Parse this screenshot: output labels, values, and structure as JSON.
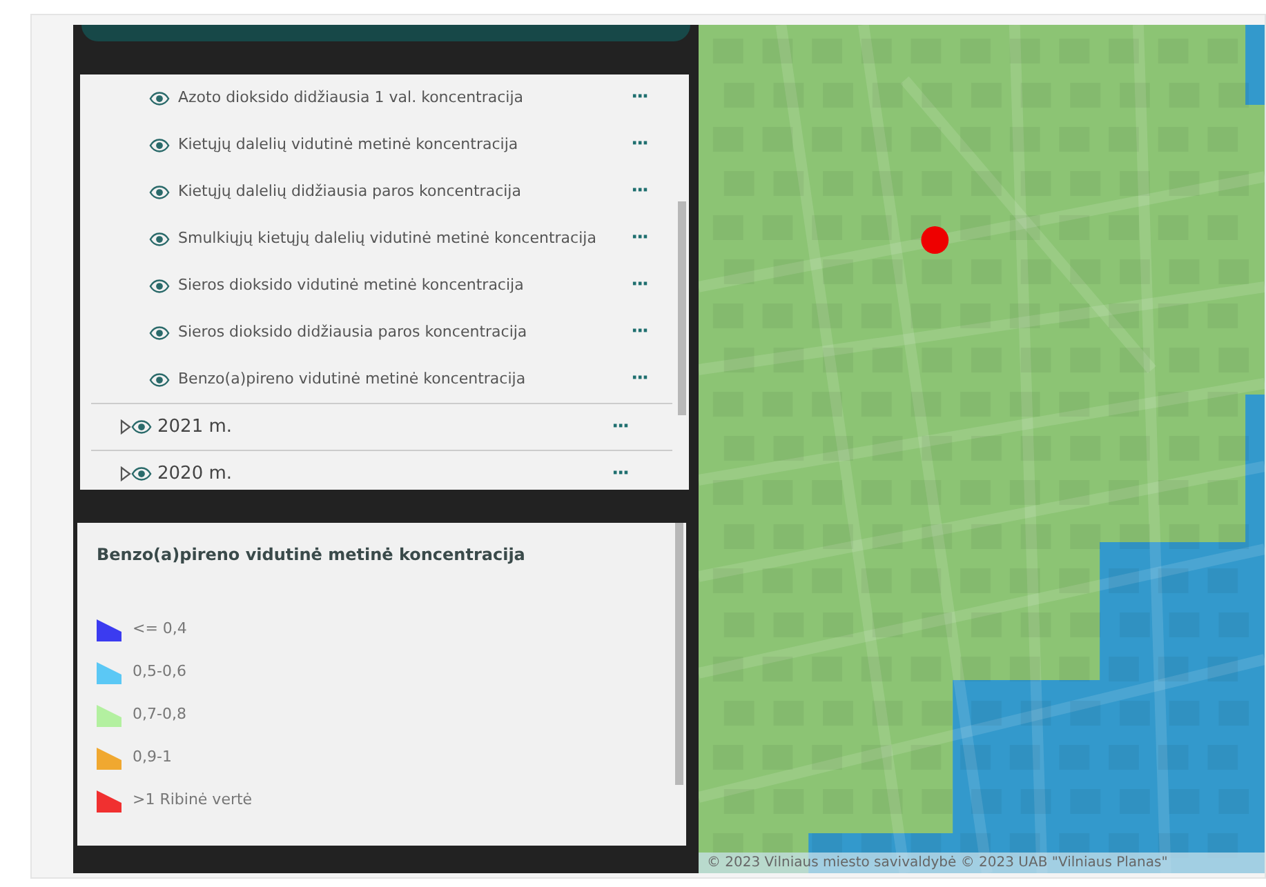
{
  "layers": {
    "items": [
      {
        "kind": "layer",
        "label": "Azoto dioksido didžiausia 1 val. koncentracija",
        "menu": "···"
      },
      {
        "kind": "layer",
        "label": "Kietųjų dalelių vidutinė metinė koncentracija",
        "menu": "···"
      },
      {
        "kind": "layer",
        "label": "Kietųjų dalelių didžiausia paros koncentracija",
        "menu": "···"
      },
      {
        "kind": "layer",
        "label": "Smulkiųjų kietųjų dalelių vidutinė metinė koncentracija",
        "menu": "···"
      },
      {
        "kind": "layer",
        "label": "Sieros dioksido vidutinė metinė koncentracija",
        "menu": "···"
      },
      {
        "kind": "layer",
        "label": "Sieros dioksido didžiausia paros koncentracija",
        "menu": "···"
      },
      {
        "kind": "layer",
        "label": "Benzo(a)pireno vidutinė metinė koncentracija",
        "menu": "···"
      },
      {
        "kind": "group",
        "label": "2021 m.",
        "expanded": false,
        "menu": "···"
      },
      {
        "kind": "group",
        "label": "2020 m.",
        "expanded": false,
        "menu": "···"
      }
    ]
  },
  "legend": {
    "title": "Benzo(a)pireno vidutinė metinė koncentracija",
    "items": [
      {
        "label": "<= 0,4",
        "color": "#3b3bf0"
      },
      {
        "label": "0,5-0,6",
        "color": "#5bc8f5"
      },
      {
        "label": "0,7-0,8",
        "color": "#b3f0a0"
      },
      {
        "label": "0,9-1",
        "color": "#f0a830"
      },
      {
        "label": ">1 Ribinė vertė",
        "color": "#f03030"
      }
    ]
  },
  "map": {
    "attribution": "© 2023 Vilniaus miesto savivaldybė © 2023 UAB \"Vilniaus Planas\""
  }
}
